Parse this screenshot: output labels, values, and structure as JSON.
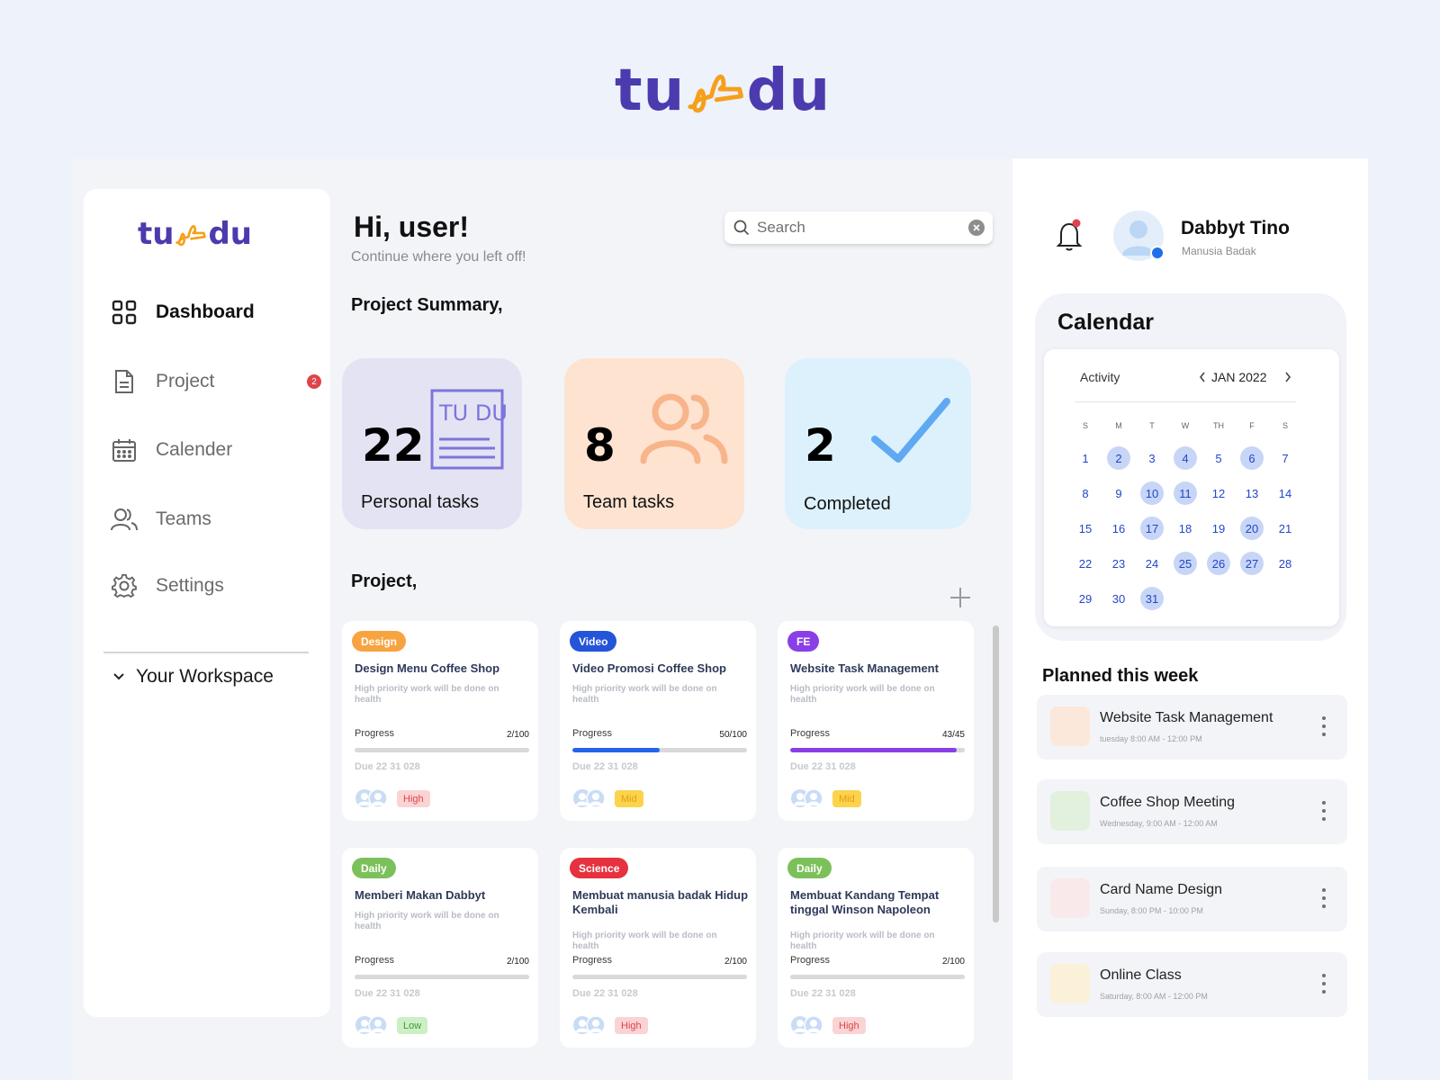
{
  "brand": {
    "logo_left": "tu",
    "logo_right": "du",
    "logo_mark": "tudu-squiggle-icon"
  },
  "sidebar": {
    "items": [
      {
        "label": "Dashboard",
        "icon": "grid-icon",
        "active": true
      },
      {
        "label": "Project",
        "icon": "document-icon",
        "badge": "2"
      },
      {
        "label": "Calender",
        "icon": "calendar-icon"
      },
      {
        "label": "Teams",
        "icon": "users-icon"
      },
      {
        "label": "Settings",
        "icon": "gear-icon"
      }
    ],
    "workspace_label": "Your Workspace"
  },
  "header": {
    "greeting": "Hi, user!",
    "subtitle": "Continue where you left off!",
    "search_placeholder": "Search"
  },
  "summary": {
    "title": "Project Summary,",
    "cards": [
      {
        "value": "22",
        "label": "Personal tasks",
        "color": "#E4E3F3",
        "art_text": "TU DU"
      },
      {
        "value": "8",
        "label": "Team tasks",
        "color": "#FDE3D0"
      },
      {
        "value": "2",
        "label": "Completed",
        "color": "#DDF1FD"
      }
    ]
  },
  "projects": {
    "title": "Project,",
    "progress_label": "Progress",
    "items": [
      {
        "tag": "Design",
        "tag_color": "#F7A440",
        "title": "Design Menu Coffee Shop",
        "desc": "High priority work will be done on health",
        "progress": "2/100",
        "progress_fraction": 0.0,
        "bar_color": "#2563EB",
        "due": "Due 22 31 028",
        "priority": "High",
        "priority_bg": "#FAD4D4",
        "priority_color": "#E0434B"
      },
      {
        "tag": "Video",
        "tag_color": "#2454D8",
        "title": "Video Promosi  Coffee Shop",
        "desc": "High priority work will be done on health",
        "progress": "50/100",
        "progress_fraction": 0.5,
        "bar_color": "#2563EB",
        "due": "Due 22 31 028",
        "priority": "Mid",
        "priority_bg": "#FCD34D",
        "priority_color": "#E59E0B"
      },
      {
        "tag": "FE",
        "tag_color": "#8A3FE6",
        "title": "Website Task Management",
        "desc": "High priority work will be done on health",
        "progress": "43/45",
        "progress_fraction": 0.955,
        "bar_color": "#8A3FE6",
        "due": "Due 22 31 028",
        "priority": "Mid",
        "priority_bg": "#FCD34D",
        "priority_color": "#E59E0B"
      },
      {
        "tag": "Daily",
        "tag_color": "#7CC05A",
        "title": "Memberi Makan Dabbyt",
        "desc": "High priority work will be done on health",
        "progress": "2/100",
        "progress_fraction": 0.0,
        "bar_color": "#2563EB",
        "due": "Due 22 31 028",
        "priority": "Low",
        "priority_bg": "#CDEFC4",
        "priority_color": "#3E9B3A"
      },
      {
        "tag": "Science",
        "tag_color": "#E6323E",
        "title": "Membuat manusia badak Hidup Kembali",
        "desc": "High priority work will be done on health",
        "progress": "2/100",
        "progress_fraction": 0.0,
        "bar_color": "#2563EB",
        "due": "Due 22 31 028",
        "priority": "High",
        "priority_bg": "#FAD4D4",
        "priority_color": "#E0434B"
      },
      {
        "tag": "Daily",
        "tag_color": "#7CC05A",
        "title": "Membuat Kandang Tempat tinggal Winson Napoleon",
        "desc": "High priority work will be done on health",
        "progress": "2/100",
        "progress_fraction": 0.0,
        "bar_color": "#2563EB",
        "due": "Due 22 31 028",
        "priority": "High",
        "priority_bg": "#FAD4D4",
        "priority_color": "#E0434B"
      }
    ]
  },
  "user": {
    "name": "Dabbyt Tino",
    "role": "Manusia Badak"
  },
  "calendar": {
    "title": "Calendar",
    "activity_label": "Activity",
    "month": "JAN 2022",
    "weekdays": [
      "S",
      "M",
      "T",
      "W",
      "TH",
      "F",
      "S"
    ],
    "first_weekday": 0,
    "days": 31,
    "highlighted": [
      2,
      4,
      6,
      10,
      11,
      17,
      20,
      25,
      26,
      27,
      31
    ]
  },
  "planned": {
    "title": "Planned this week",
    "items": [
      {
        "name": "Website Task Management",
        "time": "tuesday 8:00 AM - 12:00 PM",
        "color": "#FBE8DA"
      },
      {
        "name": "Coffee Shop Meeting",
        "time": "Wednesday, 9:00 AM - 12:00 AM",
        "color": "#E2F1DE"
      },
      {
        "name": "Card Name Design",
        "time": "Sunday, 8:00 PM - 10:00 PM",
        "color": "#FAE9EA"
      },
      {
        "name": "Online Class",
        "time": "Saturday, 8:00 AM - 12:00 PM",
        "color": "#FAF1D8"
      }
    ]
  }
}
